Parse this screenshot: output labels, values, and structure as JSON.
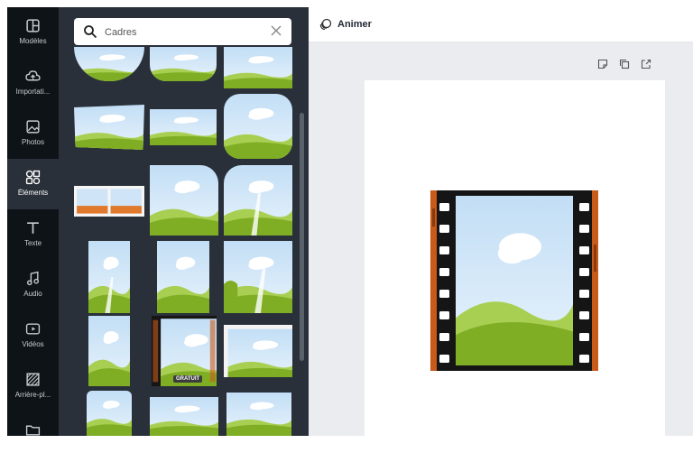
{
  "sidebar": {
    "items": [
      {
        "label": "Modèles",
        "icon": "templates-icon",
        "active": false
      },
      {
        "label": "Importati...",
        "icon": "upload-cloud-icon",
        "active": false
      },
      {
        "label": "Photos",
        "icon": "photo-icon",
        "active": false
      },
      {
        "label": "Éléments",
        "icon": "elements-shapes-icon",
        "active": true
      },
      {
        "label": "Texte",
        "icon": "text-T-icon",
        "active": false
      },
      {
        "label": "Audio",
        "icon": "music-note-icon",
        "active": false
      },
      {
        "label": "Vidéos",
        "icon": "video-play-icon",
        "active": false
      },
      {
        "label": "Arrière-pl...",
        "icon": "background-pattern-icon",
        "active": false
      },
      {
        "label": "",
        "icon": "folder-icon",
        "active": false
      }
    ]
  },
  "search": {
    "value": "Cadres",
    "icon": "search-icon",
    "clear_icon": "close-icon"
  },
  "thumbnail_badge": "GRATUIT",
  "toolbar": {
    "animate_label": "Animer",
    "animate_icon": "animate-icon"
  },
  "page_tools": [
    "add-note-icon",
    "duplicate-page-icon",
    "share-export-icon"
  ],
  "colors": {
    "sky": "#cfe5f7",
    "hill_dark": "#7fae24",
    "hill_light": "#a8cf52",
    "film": "#151515",
    "film_rust": "#c85a1a",
    "active_rail": "#293039",
    "panel": "#293039",
    "rail": "#0e1318"
  }
}
